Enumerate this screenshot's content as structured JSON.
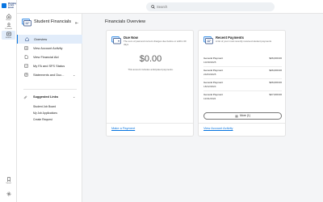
{
  "app": {
    "logo_text": "Workday Lorem Ipsum"
  },
  "rail": {
    "items": [
      {
        "label": "Home",
        "icon": "home-icon"
      },
      {
        "label": "Personal",
        "icon": "person-icon"
      },
      {
        "label": "Student",
        "icon": "student-icon"
      },
      {
        "label": "Saved",
        "icon": "bookmark-icon"
      }
    ]
  },
  "search": {
    "placeholder": "Search"
  },
  "side": {
    "title": "Student Financials",
    "nav": [
      {
        "label": "Overview"
      },
      {
        "label": "View Account Activity"
      },
      {
        "label": "View Financial Aid"
      },
      {
        "label": "My FA and SFS Status"
      },
      {
        "label": "Statements and Duc..."
      }
    ],
    "suggested_title": "Suggested Links",
    "links": [
      "Student Job Board",
      "My Job Applications",
      "Create Request"
    ]
  },
  "main": {
    "page_title": "Financials Overview",
    "due": {
      "title": "Due Now",
      "desc": "The sum of past and current charges due before or within 30 days",
      "amount": "$0.00",
      "note": "This amount includes anticipated payments.",
      "link": "Make a Payment"
    },
    "payments": {
      "title": "Recent Payments",
      "desc": "A list of your most recently received student payments",
      "rows": [
        {
          "type": "General Payment",
          "date": "10/18/2025",
          "amount": "$26,000.00"
        },
        {
          "type": "General Payment",
          "date": "24/03/2025",
          "amount": "$26,000.00"
        },
        {
          "type": "General Payment",
          "date": "18/12/2024",
          "amount": "$26,000.00"
        },
        {
          "type": "General Payment",
          "date": "11/01/2024",
          "amount": "$27,000.00"
        }
      ],
      "more_label": "More (1)",
      "link": "View Account Activity"
    }
  },
  "colors": {
    "accent": "#0875e1",
    "active_bg": "#e1ecfa"
  }
}
